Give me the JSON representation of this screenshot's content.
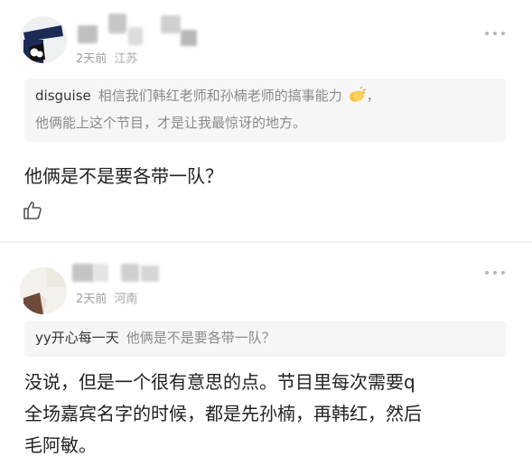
{
  "comments": [
    {
      "time": "2天前",
      "location": "江苏",
      "quote": {
        "user": "disguise",
        "line1": "相信我们韩红老师和孙楠老师的搞事能力",
        "punct": "，",
        "line2": "他俩能上这个节目，才是让我最惊讶的地方。"
      },
      "text": "他俩是不是要各带一队？"
    },
    {
      "time": "2天前",
      "location": "河南",
      "quote": {
        "user": "yy开心每一天",
        "line1": "他俩是不是要各带一队？"
      },
      "text_lines": [
        "没说，但是一个很有意思的点。节目里每次需要q",
        "全场嘉宾名字的时候，都是先孙楠，再韩红，然后",
        "毛阿敏。"
      ]
    }
  ],
  "icons": {
    "avatar_1": "avatar",
    "avatar_2": "avatar",
    "more": "more-dots-icon",
    "like": "thumbs-up-icon",
    "emoji": "clapping-hands-emoji"
  },
  "colors": {
    "meta": "#a0a0a0",
    "quote_bg": "#f6f6f6",
    "quote_text": "#8a8a8a",
    "body_text": "#222222",
    "divider": "#f0f0f0"
  }
}
